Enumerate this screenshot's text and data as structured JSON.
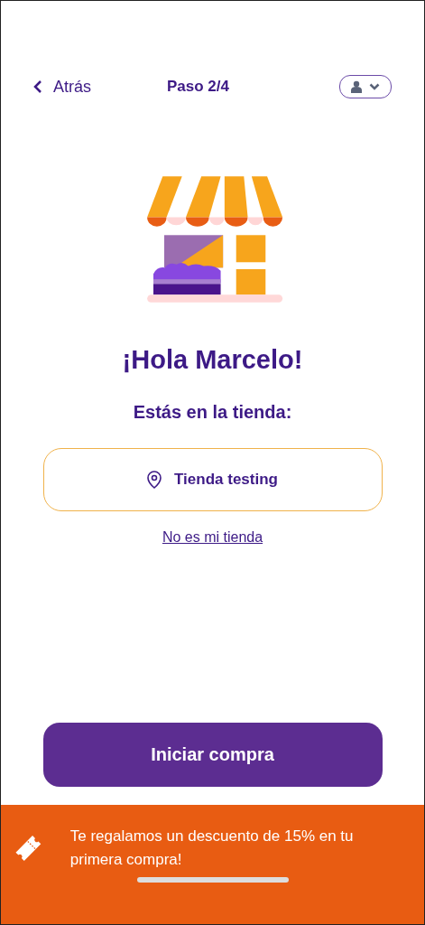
{
  "header": {
    "back_label": "Atrás",
    "step": "Paso 2/4"
  },
  "greeting": "¡Hola Marcelo!",
  "store_prompt": "Estás en la tienda:",
  "store": {
    "name": "Tienda testing"
  },
  "change_store_link": "No es mi tienda",
  "primary_button": "Iniciar compra",
  "promo_banner": {
    "text": "Te regalamos un descuento de 15% en tu primera compra!"
  }
}
